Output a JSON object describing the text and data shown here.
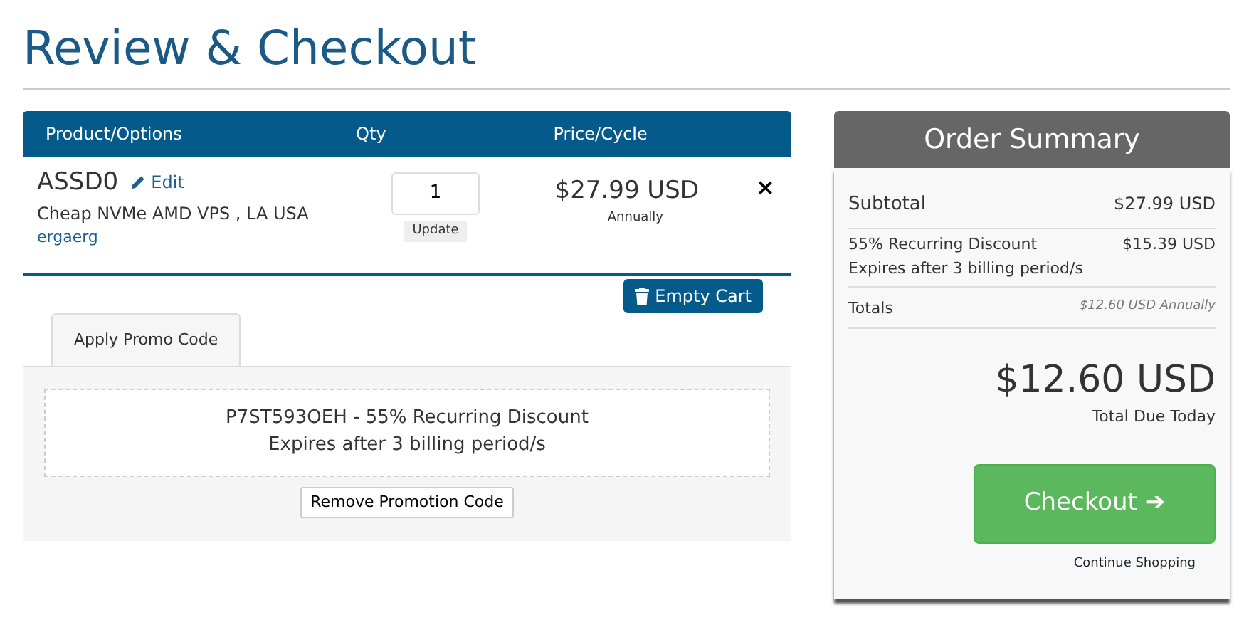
{
  "page_title": "Review & Checkout",
  "cart": {
    "columns": [
      "Product/Options",
      "Qty",
      "Price/Cycle"
    ],
    "items": [
      {
        "name": "ASSD0",
        "edit_label": "Edit",
        "description": "Cheap NVMe AMD VPS , LA USA",
        "domain": "ergaerg",
        "quantity": "1",
        "update_label": "Update",
        "price": "$27.99 USD",
        "cycle": "Annually",
        "remove_label": "×"
      }
    ],
    "empty_cart_label": "Empty Cart"
  },
  "promo": {
    "tabs": [
      {
        "label": "Apply Promo Code",
        "selected": true
      }
    ],
    "applied_code": "P7ST593OEH - 55% Recurring Discount",
    "expiry": "Expires after 3 billing period/s",
    "remove_label": "Remove Promotion Code"
  },
  "summary": {
    "title": "Order Summary",
    "lines": [
      {
        "label": "Subtotal",
        "value": "$27.99 USD"
      },
      {
        "label": "55% Recurring Discount",
        "value": "$15.39 USD",
        "note": "Expires after 3 billing period/s"
      },
      {
        "label": "Totals",
        "value": "$12.60 USD Annually"
      }
    ],
    "total": "$12.60 USD",
    "total_label": "Total Due Today",
    "checkout_label": "Checkout",
    "checkout_arrow": "➔",
    "continue_label": "Continue Shopping"
  }
}
